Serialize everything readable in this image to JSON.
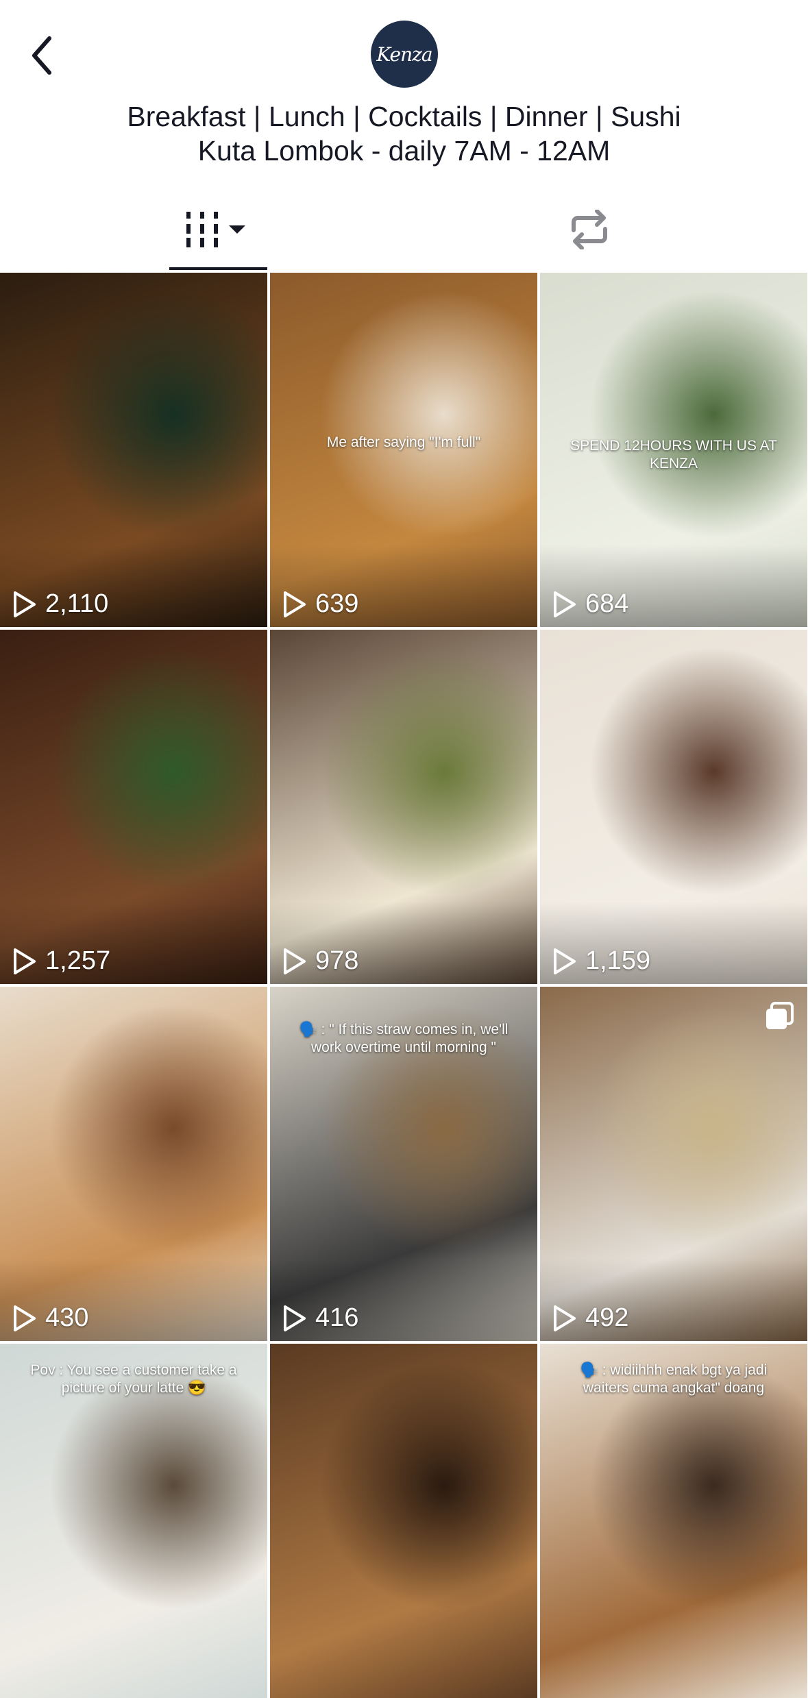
{
  "profile": {
    "avatar_text": "Kenza",
    "bio_line1": "Breakfast | Lunch | Cocktails | Dinner | Sushi",
    "bio_line2": "Kuta Lombok - daily 7AM - 12AM"
  },
  "tabs": [
    {
      "icon": "videos-grid-icon",
      "selected": true
    },
    {
      "icon": "repost-icon",
      "selected": false
    }
  ],
  "videos": [
    {
      "views": "2,110",
      "overlay": "",
      "palette": [
        "#2b1d10",
        "#7a4a22",
        "#163022"
      ]
    },
    {
      "views": "639",
      "overlay": "Me after saying \"I'm full\"",
      "palette": [
        "#8b5a2b",
        "#c4873f",
        "#e8dccb"
      ]
    },
    {
      "views": "684",
      "overlay": "SPEND 12HOURS WITH US AT KENZA",
      "palette": [
        "#d9ddd0",
        "#eef0e6",
        "#4b6a3a"
      ]
    },
    {
      "views": "1,257",
      "overlay": "",
      "palette": [
        "#3a1f12",
        "#7a4a2a",
        "#2f5a2a"
      ]
    },
    {
      "views": "978",
      "overlay": "",
      "palette": [
        "#5b4636",
        "#efe6d2",
        "#6b7a3a"
      ]
    },
    {
      "views": "1,159",
      "overlay": "",
      "palette": [
        "#e9e1d6",
        "#f2ede5",
        "#5a3a2a"
      ]
    },
    {
      "views": "430",
      "overlay": "",
      "palette": [
        "#e8dccb",
        "#c98f55",
        "#7a4a2a"
      ]
    },
    {
      "views": "416",
      "overlay": "🗣️ : \" If this straw comes in, we'll work overtime until morning \"",
      "palette": [
        "#d8d3c8",
        "#3a3a3a",
        "#8a6a44"
      ]
    },
    {
      "views": "492",
      "overlay": "",
      "palette": [
        "#8a6a4a",
        "#e5e0d8",
        "#c9b58a"
      ],
      "multi": true
    },
    {
      "views": "",
      "overlay": "Pov : You see a customer take a picture of your latte 😎",
      "palette": [
        "#cfd8d6",
        "#f0ede6",
        "#5a4a3a"
      ]
    },
    {
      "views": "",
      "overlay": "",
      "palette": [
        "#5a3a22",
        "#b07a44",
        "#2a1a10"
      ]
    },
    {
      "views": "",
      "overlay": "🗣️ : widiihhh enak bgt ya jadi waiters cuma angkat\" doang",
      "palette": [
        "#e8e0d4",
        "#a06a3a",
        "#3a2a20"
      ]
    }
  ]
}
